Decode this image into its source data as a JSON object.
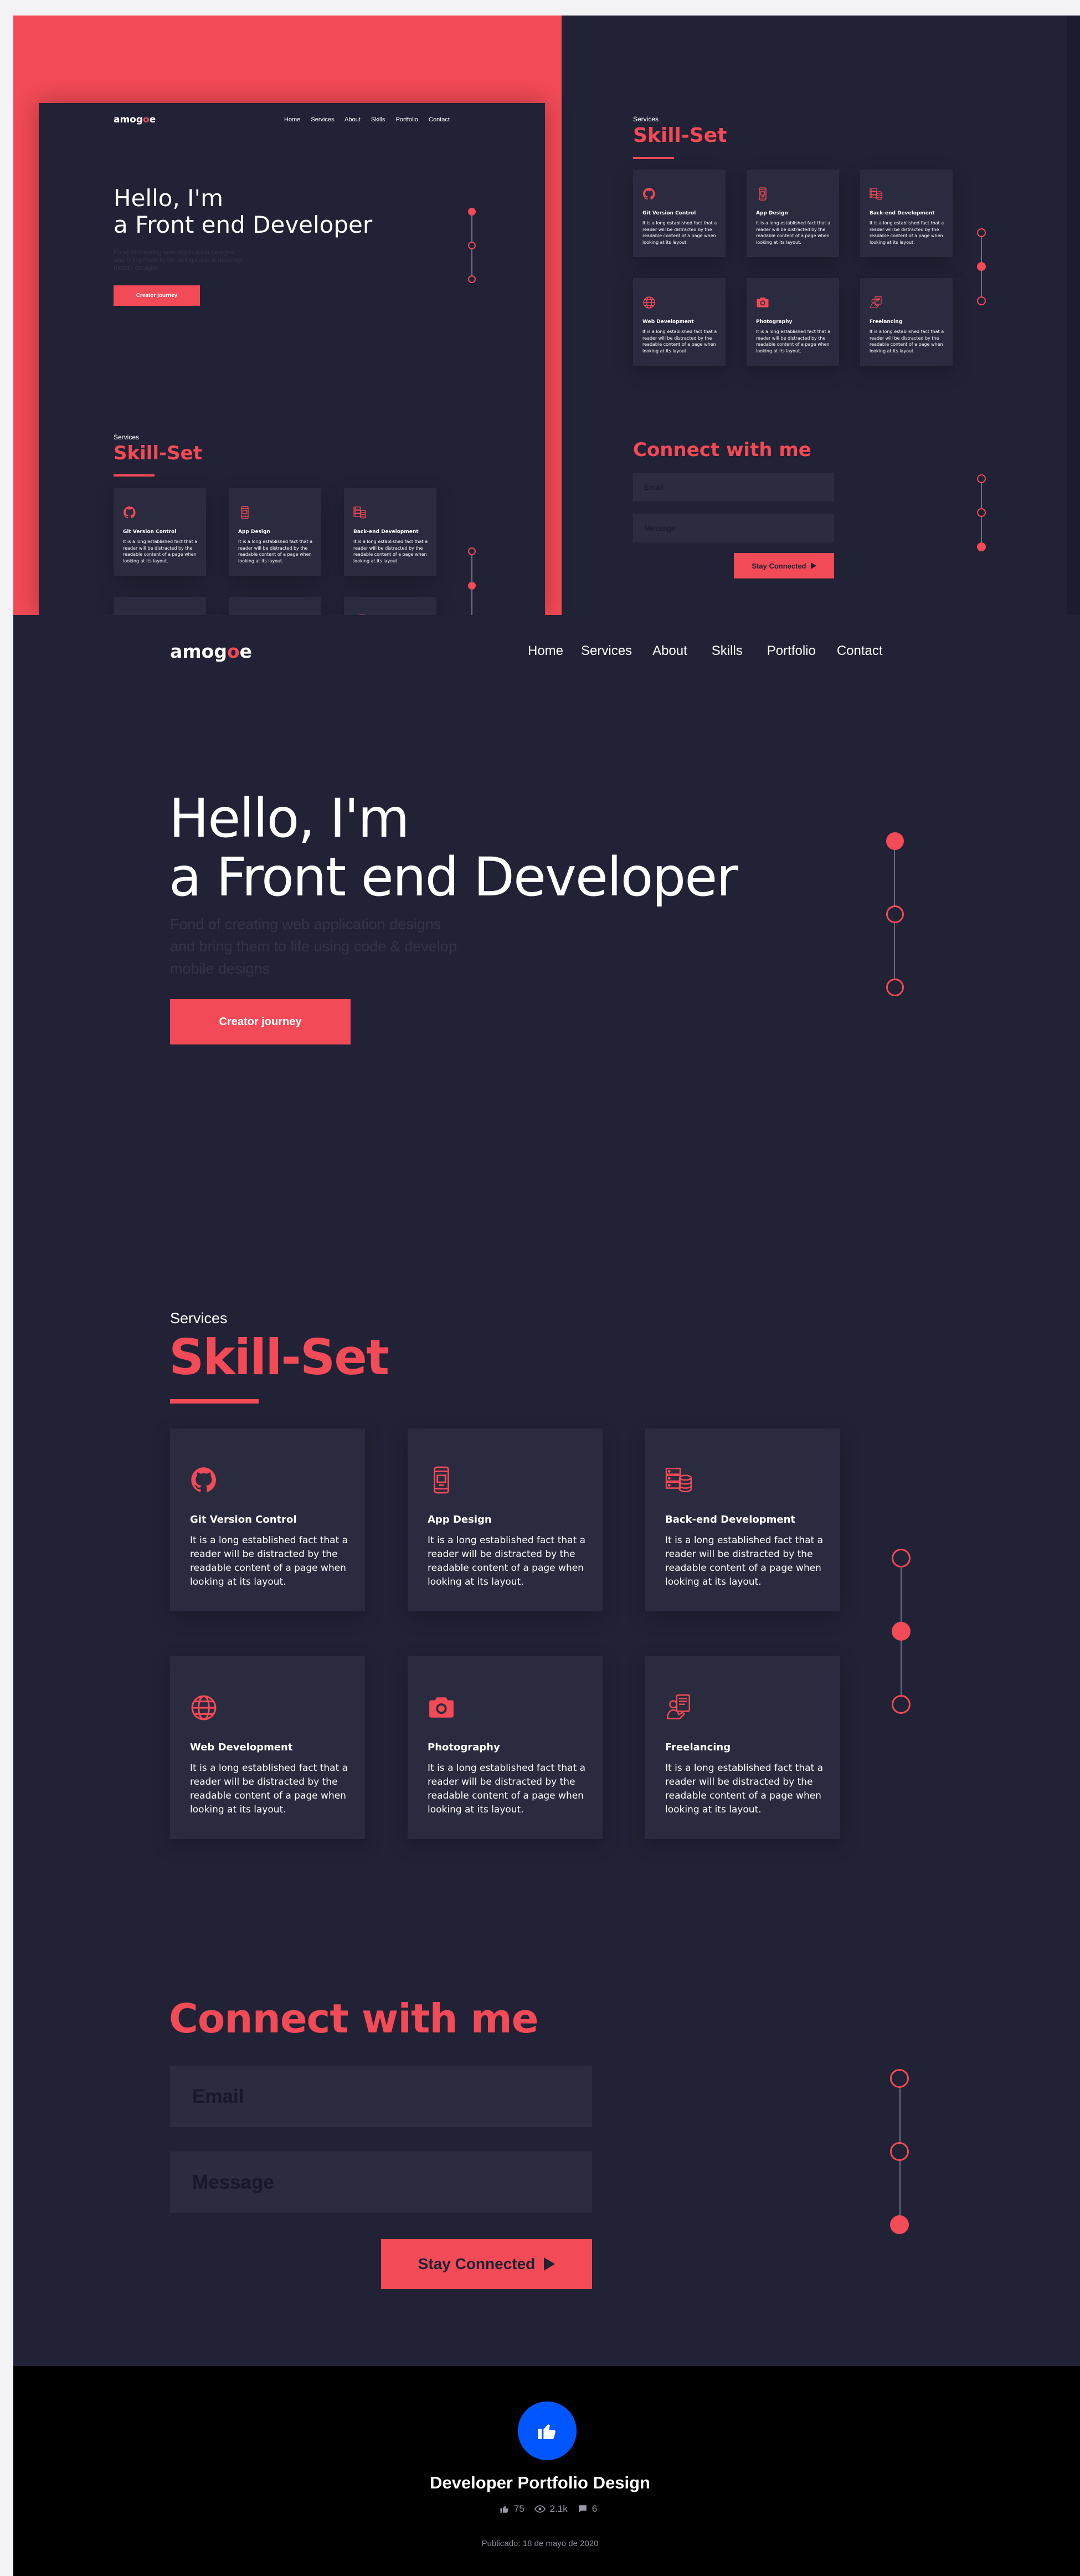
{
  "brand": {
    "logo_prefix": "amog",
    "logo_accent": "o",
    "logo_suffix": "e"
  },
  "nav": [
    "Home",
    "Services",
    "About",
    "Skills",
    "Portfolio",
    "Contact"
  ],
  "hero": {
    "line1": "Hello, I'm",
    "line2": "a Front end Developer",
    "subtitle_l1": "Fond of creating web application designs",
    "subtitle_l2": "and bring them to life using code & develop",
    "subtitle_l3": "mobile designs",
    "cta": "Creator journey"
  },
  "skills": {
    "eyebrow": "Services",
    "title": "Skill-Set",
    "items": [
      {
        "icon": "github-icon",
        "title": "Git Version Control",
        "l1": "It is a long established fact that a",
        "l2": "reader will be distracted by the",
        "l3": "readable content of a page when",
        "l4": "looking at its layout."
      },
      {
        "icon": "mobile-app-icon",
        "title": "App Design",
        "l1": "It is a long established fact that a",
        "l2": "reader will be distracted by the",
        "l3": "readable content of a page when",
        "l4": "looking at its layout."
      },
      {
        "icon": "server-database-icon",
        "title": "Back-end Development",
        "l1": "It is a long established fact that a",
        "l2": "reader will be distracted by the",
        "l3": "readable content of a page when",
        "l4": "looking at its layout."
      },
      {
        "icon": "globe-icon",
        "title": "Web Development",
        "l1": "It is a long established fact that a",
        "l2": "reader will be distracted by the",
        "l3": "readable content of a page when",
        "l4": "looking at its layout."
      },
      {
        "icon": "camera-icon",
        "title": "Photography",
        "l1": "It is a long established fact that a",
        "l2": "reader will be distracted by the",
        "l3": "readable content of a page when",
        "l4": "looking at its layout."
      },
      {
        "icon": "freelancer-icon",
        "title": "Freelancing",
        "l1": "It is a long established fact that a",
        "l2": "reader will be distracted by the",
        "l3": "readable content of a page when",
        "l4": "looking at its layout."
      }
    ]
  },
  "connect": {
    "title": "Connect with me",
    "email_placeholder": "Email",
    "message_placeholder": "Message",
    "button": "Stay Connected"
  },
  "footer": {
    "title": "Developer Portfolio Design",
    "likes": "75",
    "views": "2.1k",
    "comments": "6",
    "published": "Publicado: 18 de mayo de 2020"
  },
  "colors": {
    "accent": "#f24a56",
    "bg": "#212235",
    "card": "#2a2b3e"
  }
}
